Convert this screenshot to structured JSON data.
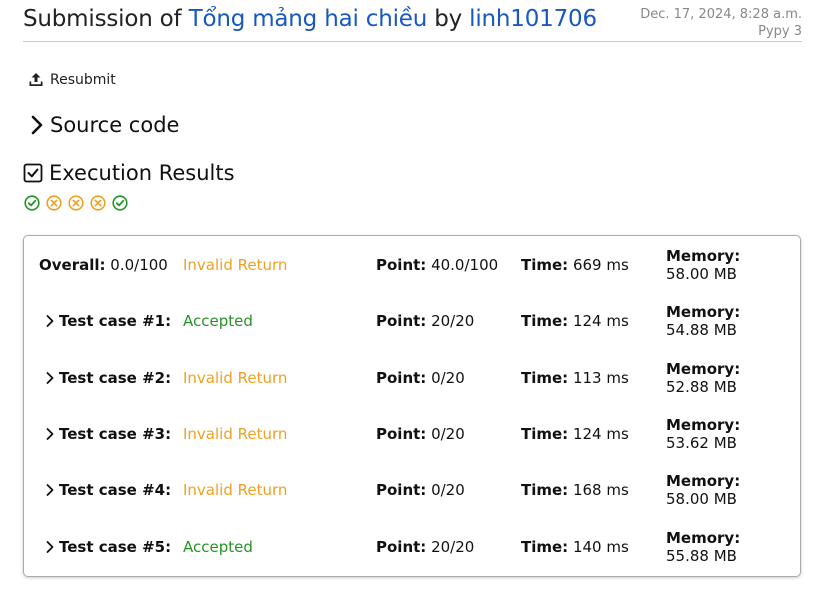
{
  "header": {
    "prefix": "Submission of",
    "problem": "Tổng mảng hai chiều",
    "by": "by",
    "user": "linh101706",
    "date": "Dec. 17, 2024, 8:28 a.m.",
    "language": "Pypy 3"
  },
  "actions": {
    "resubmit": "Resubmit",
    "source_code": "Source code"
  },
  "execution": {
    "title": "Execution Results",
    "status_icons": [
      "check-circle-icon",
      "x-circle-icon",
      "x-circle-icon",
      "x-circle-icon",
      "check-circle-icon"
    ]
  },
  "colors": {
    "link": "#1958c1",
    "accepted": "#259425",
    "invalid": "#f0a020"
  },
  "overall": {
    "label": "Overall:",
    "score": "0.0/100",
    "status": "Invalid Return",
    "point_label": "Point:",
    "point": "40.0/100",
    "time_label": "Time:",
    "time": "669 ms",
    "memory_label": "Memory:",
    "memory": "58.00 MB"
  },
  "test_cases": [
    {
      "label": "Test case #1:",
      "status": "Accepted",
      "point_label": "Point:",
      "point": "20/20",
      "time_label": "Time:",
      "time": "124 ms",
      "memory_label": "Memory:",
      "memory": "54.88 MB"
    },
    {
      "label": "Test case #2:",
      "status": "Invalid Return",
      "point_label": "Point:",
      "point": "0/20",
      "time_label": "Time:",
      "time": "113 ms",
      "memory_label": "Memory:",
      "memory": "52.88 MB"
    },
    {
      "label": "Test case #3:",
      "status": "Invalid Return",
      "point_label": "Point:",
      "point": "0/20",
      "time_label": "Time:",
      "time": "124 ms",
      "memory_label": "Memory:",
      "memory": "53.62 MB"
    },
    {
      "label": "Test case #4:",
      "status": "Invalid Return",
      "point_label": "Point:",
      "point": "0/20",
      "time_label": "Time:",
      "time": "168 ms",
      "memory_label": "Memory:",
      "memory": "58.00 MB"
    },
    {
      "label": "Test case #5:",
      "status": "Accepted",
      "point_label": "Point:",
      "point": "20/20",
      "time_label": "Time:",
      "time": "140 ms",
      "memory_label": "Memory:",
      "memory": "55.88 MB"
    }
  ]
}
